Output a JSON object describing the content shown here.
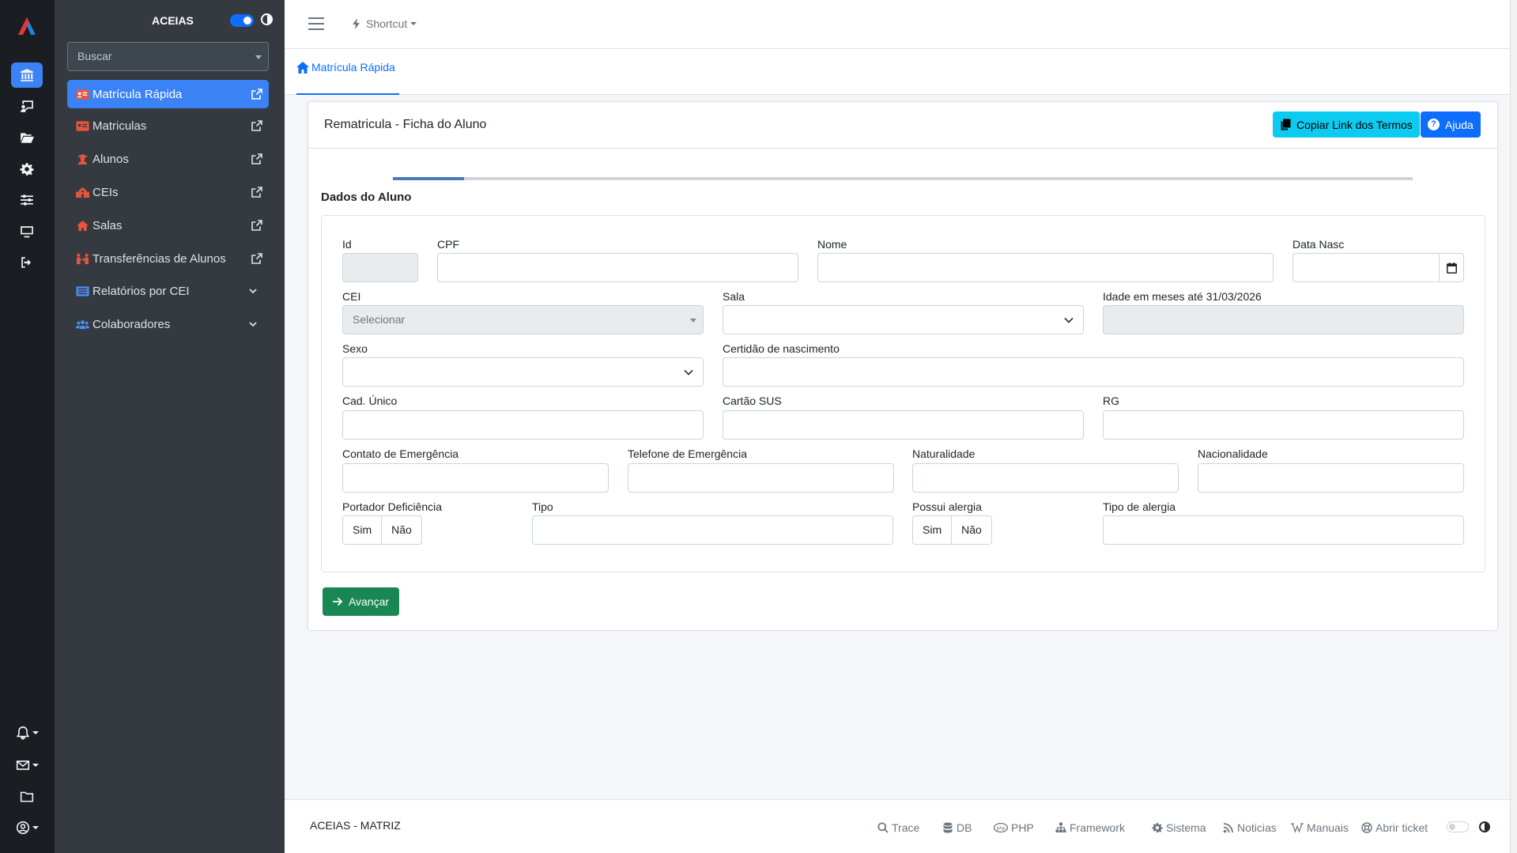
{
  "sidebar": {
    "brand": "ACEIAS",
    "search_placeholder": "Buscar",
    "items": [
      {
        "label": "Matrícula Rápida",
        "icon": "id-card-icon",
        "active": true
      },
      {
        "label": "Matriculas",
        "icon": "id-card-icon"
      },
      {
        "label": "Alunos",
        "icon": "student-icon"
      },
      {
        "label": "CEIs",
        "icon": "school-icon"
      },
      {
        "label": "Salas",
        "icon": "house-icon"
      },
      {
        "label": "Transferências de Alunos",
        "icon": "people-arrows-icon"
      },
      {
        "label": "Relatórios por CEI",
        "icon": "list-icon"
      },
      {
        "label": "Colaboradores",
        "icon": "users-icon"
      }
    ]
  },
  "topbar": {
    "shortcut_label": "Shortcut"
  },
  "breadcrumb": {
    "tab_label": "Matrícula Rápida"
  },
  "card": {
    "title": "Rematricula - Ficha do Aluno",
    "copy_button": "Copiar Link dos Termos",
    "help_button": "Ajuda",
    "progress": 0.07,
    "section_title": "Dados do Aluno",
    "next_button": "Avançar"
  },
  "form": {
    "id": "Id",
    "cpf": "CPF",
    "nome": "Nome",
    "data_nasc": "Data Nasc",
    "cei": "CEI",
    "cei_placeholder": "Selecionar",
    "sala": "Sala",
    "idade": "Idade em meses até 31/03/2026",
    "sexo": "Sexo",
    "certidao": "Certidão de nascimento",
    "cad_unico": "Cad. Único",
    "cartao_sus": "Cartão SUS",
    "rg": "RG",
    "contato_emergencia": "Contato de Emergência",
    "telefone_emergencia": "Telefone de Emergência",
    "naturalidade": "Naturalidade",
    "nacionalidade": "Nacionalidade",
    "portador_deficiencia": "Portador Deficiência",
    "tipo": "Tipo",
    "possui_alergia": "Possui alergia",
    "tipo_alergia": "Tipo de alergia",
    "sim": "Sim",
    "nao": "Não"
  },
  "footer": {
    "brand": "ACEIAS - MATRIZ",
    "links": [
      "Trace",
      "DB",
      "PHP",
      "Framework",
      "Sistema",
      "Noticias",
      "Manuais",
      "Abrir ticket"
    ]
  },
  "colors": {
    "primary": "#0d6efd",
    "sidebar_bg": "#343a40",
    "rail_bg": "#1a1d21",
    "info": "#0dcaf0",
    "success": "#198754",
    "nav_icon_red": "#e8553e"
  }
}
